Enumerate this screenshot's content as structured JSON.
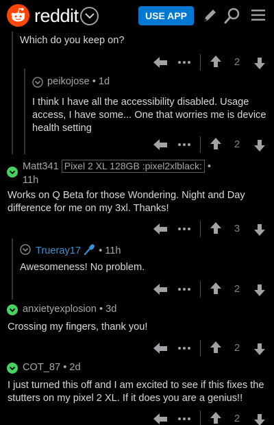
{
  "header": {
    "wordmark": "reddit",
    "use_app_label": "USE APP",
    "icons": [
      "reddit-logo-icon",
      "chevron-down-icon",
      "pencil-icon",
      "search-icon",
      "menu-icon"
    ]
  },
  "comments": [
    {
      "body": "Which do you keep on?",
      "score": "2"
    },
    {
      "username": "peikojose",
      "age": "• 1d",
      "body": "I think I have all the accessibility disabled. Usage access, I have some... One that worries me is device health setting",
      "score": "2"
    },
    {
      "username": "Matt341",
      "flair": "Pixel 2 XL 128GB :pixel2xlblack:",
      "age_bullet": "•",
      "age": "11h",
      "body": "Works on Q Beta for those Wondering. Night and Day difference for me on my 3xl. Thanks!",
      "score": "3"
    },
    {
      "username": "Trueray17",
      "age": "• 11h",
      "body": "Awesomeness! No problem.",
      "score": "2"
    },
    {
      "username": "anxietyexplosion",
      "age": "• 3d",
      "body": "Crossing my fingers, thank you!",
      "score": "2"
    },
    {
      "username": "COT_87",
      "age": "• 2d",
      "body": "I just turned this off and I am excited to see if this fixes the stutters on my pixel 2 XL. If it does you are a genius!!",
      "score": "2"
    }
  ],
  "colors": {
    "background": "#000000",
    "brand": "#ff4500",
    "button": "#0079d3",
    "text": "#d7dadc",
    "muted": "#a4a8ab",
    "collapse_green": "#46d160",
    "op_blue": "#3d8fd5"
  }
}
